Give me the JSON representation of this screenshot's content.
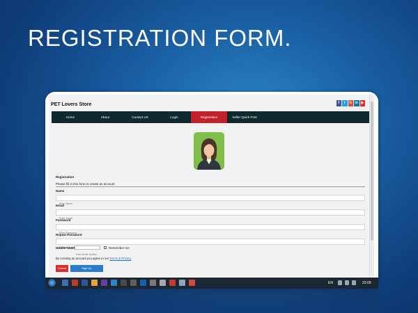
{
  "slide_title": "REGISTRATION FORM.",
  "store": {
    "title": "PET Lovers Store"
  },
  "social_icons": [
    {
      "name": "facebook-icon",
      "glyph": "f",
      "color": "#3b5998"
    },
    {
      "name": "twitter-icon",
      "glyph": "t",
      "color": "#1da1f2"
    },
    {
      "name": "google-plus-icon",
      "glyph": "G",
      "color": "#dd4b39"
    },
    {
      "name": "linkedin-icon",
      "glyph": "in",
      "color": "#0e76a8"
    },
    {
      "name": "youtube-icon",
      "glyph": "▶",
      "color": "#e52d27"
    }
  ],
  "nav": {
    "items": [
      {
        "label": "Home"
      },
      {
        "label": "About"
      },
      {
        "label": "Contact US"
      },
      {
        "label": "Login"
      },
      {
        "label": "Registration",
        "active": true
      },
      {
        "label": "Seller Quick Post"
      }
    ]
  },
  "form": {
    "heading": "Registration",
    "subtitle": "Please fill in this form to create an account",
    "name_label": "Name",
    "name_placeholder": "Enter Name",
    "email_label": "Email",
    "email_placeholder": "Enter Email",
    "password_label": "Password",
    "password_placeholder": "Enter Password",
    "repeat_label": "Repeat Password",
    "repeat_placeholder": "Repeat Password",
    "mobile_label": "Mobile Number",
    "mobile_placeholder": "Enter Mobile Number",
    "remember_label": "Remember me",
    "terms_prefix": "By creating an account you agree to our",
    "terms_link": "Terms & Privacy",
    "cancel_label": "Cancel",
    "signup_label": "Sign Up"
  },
  "taskbar": {
    "language": "EN",
    "time": "23:09"
  },
  "colors": {
    "nav_bg": "#0f2a2f",
    "nav_active": "#c2202a",
    "cancel": "#d9302d",
    "signup": "#2a7ccc",
    "avatar_bg": "#7fbe4a"
  }
}
